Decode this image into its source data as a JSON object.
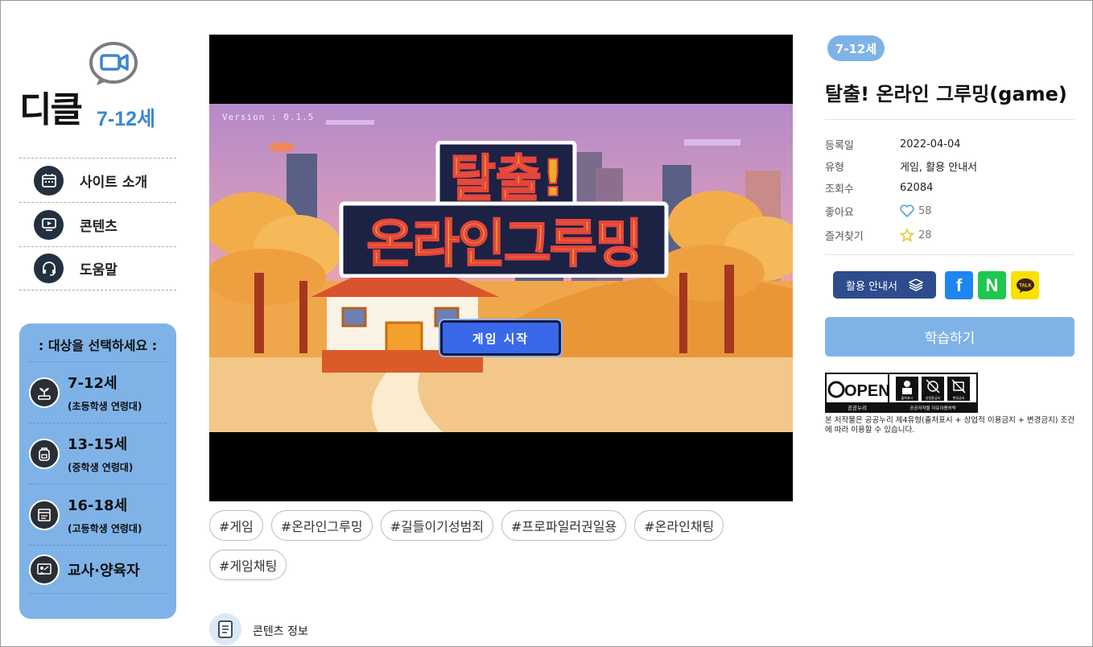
{
  "logo": {
    "brand": "디클",
    "age": "7-12세",
    "bubble_icon": "video-camera-icon"
  },
  "nav": [
    {
      "label": "사이트 소개",
      "icon": "calendar-icon"
    },
    {
      "label": "콘텐츠",
      "icon": "play-monitor-icon"
    },
    {
      "label": "도움말",
      "icon": "headset-icon"
    }
  ],
  "target": {
    "title": ": 대상을 선택하세요 :",
    "items": [
      {
        "label": "7-12세",
        "sub": "(초등학생 연령대)",
        "icon": "sprout-icon"
      },
      {
        "label": "13-15세",
        "sub": "(중학생 연령대)",
        "icon": "backpack-icon"
      },
      {
        "label": "16-18세",
        "sub": "(고등학생 연령대)",
        "icon": "book-icon"
      },
      {
        "label": "교사·양육자",
        "sub": "",
        "icon": "teacher-icon"
      }
    ]
  },
  "player": {
    "version": "Version : 0.1.5",
    "game_title_line1": "탈출!",
    "game_title_line2": "온라인그루밍",
    "start_button": "게임 시작"
  },
  "tags": [
    "#게임",
    "#온라인그루밍",
    "#길들이기성범죄",
    "#프로파일러권일용",
    "#온라인채팅",
    "#게임채팅"
  ],
  "content_info": {
    "label": "콘텐츠 정보",
    "icon": "document-icon"
  },
  "detail": {
    "badge": "7-12세",
    "title": "탈출! 온라인 그루밍(game)",
    "meta": [
      {
        "key": "등록일",
        "value": "2022-04-04"
      },
      {
        "key": "유형",
        "value": "게임, 활용 안내서"
      },
      {
        "key": "조회수",
        "value": "62084"
      },
      {
        "key": "좋아요",
        "value": "58"
      },
      {
        "key": "즐겨찾기",
        "value": "28"
      }
    ],
    "guide_button": "활용 안내서",
    "share": {
      "facebook": "f",
      "naver": "N",
      "kakao": "TALK"
    },
    "learn_button": "학습하기",
    "license": {
      "open": "OPEN",
      "kogl": "공공누리",
      "sub": "공공저작물 자유이용허락",
      "badges": [
        "출처표시",
        "상업용금지",
        "변경금지"
      ],
      "notice": "본 저작물은 공공누리 제4유형(출처표시 + 상업적 이용금지 + 변경금지) 조건에 따라 이용할 수 있습니다."
    }
  },
  "colors": {
    "accent": "#7fb3e8",
    "navy": "#2e4b8e",
    "brand_blue": "#3b86d4",
    "brand_red": "#e0242c"
  }
}
